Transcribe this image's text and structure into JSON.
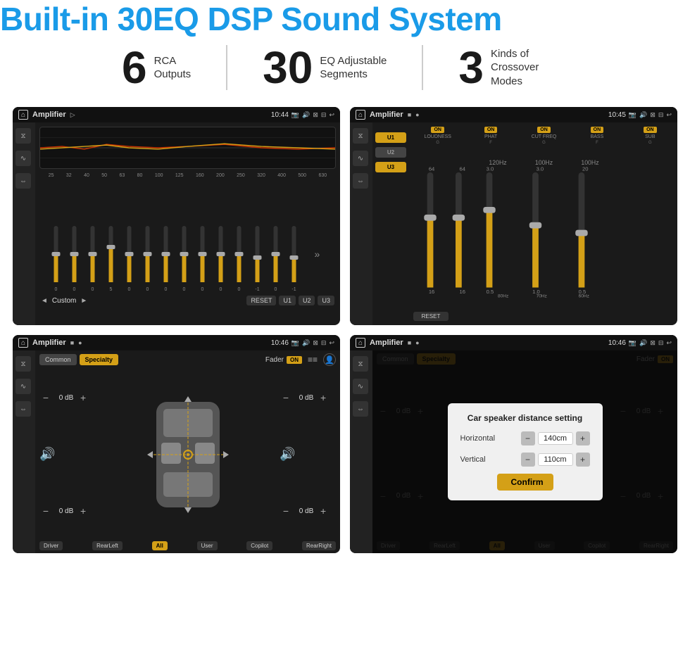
{
  "header": {
    "title": "Built-in 30EQ DSP Sound System"
  },
  "stats": [
    {
      "number": "6",
      "text": "RCA\nOutputs"
    },
    {
      "number": "30",
      "text": "EQ Adjustable\nSegments"
    },
    {
      "number": "3",
      "text": "Kinds of\nCrossover Modes"
    }
  ],
  "screens": [
    {
      "id": "screen1",
      "statusbar": {
        "app": "Amplifier",
        "time": "10:44",
        "icons": "▷ ✦ ⊙ ⊠ ⊟ ↩"
      },
      "eq_labels": [
        "25",
        "32",
        "40",
        "50",
        "63",
        "80",
        "100",
        "125",
        "160",
        "200",
        "250",
        "320",
        "400",
        "500",
        "630"
      ],
      "eq_values": [
        "0",
        "0",
        "0",
        "5",
        "0",
        "0",
        "0",
        "0",
        "0",
        "0",
        "0",
        "-1",
        "0",
        "-1"
      ],
      "presets": [
        "Custom",
        "RESET",
        "U1",
        "U2",
        "U3"
      ]
    },
    {
      "id": "screen2",
      "statusbar": {
        "app": "Amplifier",
        "time": "10:45",
        "icons": "■ ✦ ⊙ ⊠ ⊟ ↩"
      },
      "presets": [
        "U1",
        "U2",
        "U3"
      ],
      "sections": [
        {
          "toggle": "ON",
          "label": "LOUDNESS",
          "sublabel": "G"
        },
        {
          "toggle": "ON",
          "label": "PHAT",
          "sublabel": "F"
        },
        {
          "toggle": "ON",
          "label": "CUT FREQ",
          "sublabel": "G",
          "freq": "120Hz"
        },
        {
          "toggle": "ON",
          "label": "BASS",
          "sublabel": "F",
          "freq": "100Hz"
        },
        {
          "toggle": "ON",
          "label": "SUB",
          "sublabel": "G",
          "freq": "60Hz"
        }
      ],
      "reset_label": "RESET"
    },
    {
      "id": "screen3",
      "statusbar": {
        "app": "Amplifier",
        "time": "10:46",
        "icons": "■ ✦ ⊙ ⊠ ⊟ ↩"
      },
      "buttons": [
        "Common",
        "Specialty"
      ],
      "fader_label": "Fader",
      "fader_toggle": "ON",
      "vol_rows": [
        {
          "label": "0 dB"
        },
        {
          "label": "0 dB"
        },
        {
          "label": "0 dB"
        },
        {
          "label": "0 dB"
        }
      ],
      "bottom_btns": [
        "Driver",
        "RearLeft",
        "All",
        "User",
        "Copilot",
        "RearRight"
      ]
    },
    {
      "id": "screen4",
      "statusbar": {
        "app": "Amplifier",
        "time": "10:46",
        "icons": "■ ✦ ⊙ ⊠ ⊟ ↩"
      },
      "dialog": {
        "title": "Car speaker distance setting",
        "horizontal_label": "Horizontal",
        "horizontal_value": "140cm",
        "vertical_label": "Vertical",
        "vertical_value": "110cm",
        "confirm_label": "Confirm"
      },
      "bottom_btns": [
        "Driver",
        "RearLeft",
        "All",
        "User",
        "Copilot",
        "RearRight"
      ]
    }
  ],
  "colors": {
    "accent": "#d4a017",
    "blue": "#1a9be8",
    "bg_dark": "#1a1a1a",
    "text_light": "#dddddd"
  }
}
